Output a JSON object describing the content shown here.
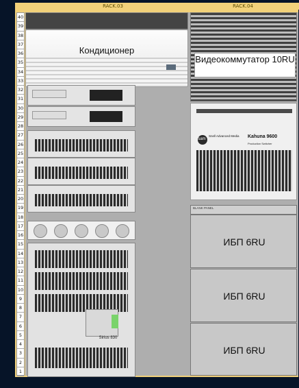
{
  "racks": {
    "left": {
      "label": "RACK.03",
      "devices": {
        "ac": "Кондиционер",
        "chassis_model": "Sirius 830"
      }
    },
    "right": {
      "label": "RACK.04",
      "devices": {
        "video_switch": "Видеокоммутатор 10RU",
        "switcher_brand": "Kahuna 9600",
        "switcher_sub": "Production Switcher",
        "sam_logo": "sam",
        "sam_text": "Snell Advanced Media",
        "blank_panel": "BLANK PANEL",
        "ups": [
          "ИБП 6RU",
          "ИБП 6RU",
          "ИБП 6RU"
        ]
      }
    }
  },
  "unit_numbers": [
    40,
    39,
    38,
    37,
    36,
    35,
    34,
    33,
    32,
    31,
    30,
    29,
    28,
    27,
    26,
    25,
    24,
    23,
    22,
    21,
    20,
    19,
    18,
    17,
    16,
    15,
    14,
    13,
    12,
    11,
    10,
    9,
    8,
    7,
    6,
    5,
    4,
    3,
    2,
    1
  ],
  "colors": {
    "background": "#061428",
    "header": "#f2d17a",
    "rack_bg": "#aeaeae",
    "unit_strip": "#ffffff",
    "ups_bg": "#c8c8c8",
    "led": "#7ad36b"
  }
}
